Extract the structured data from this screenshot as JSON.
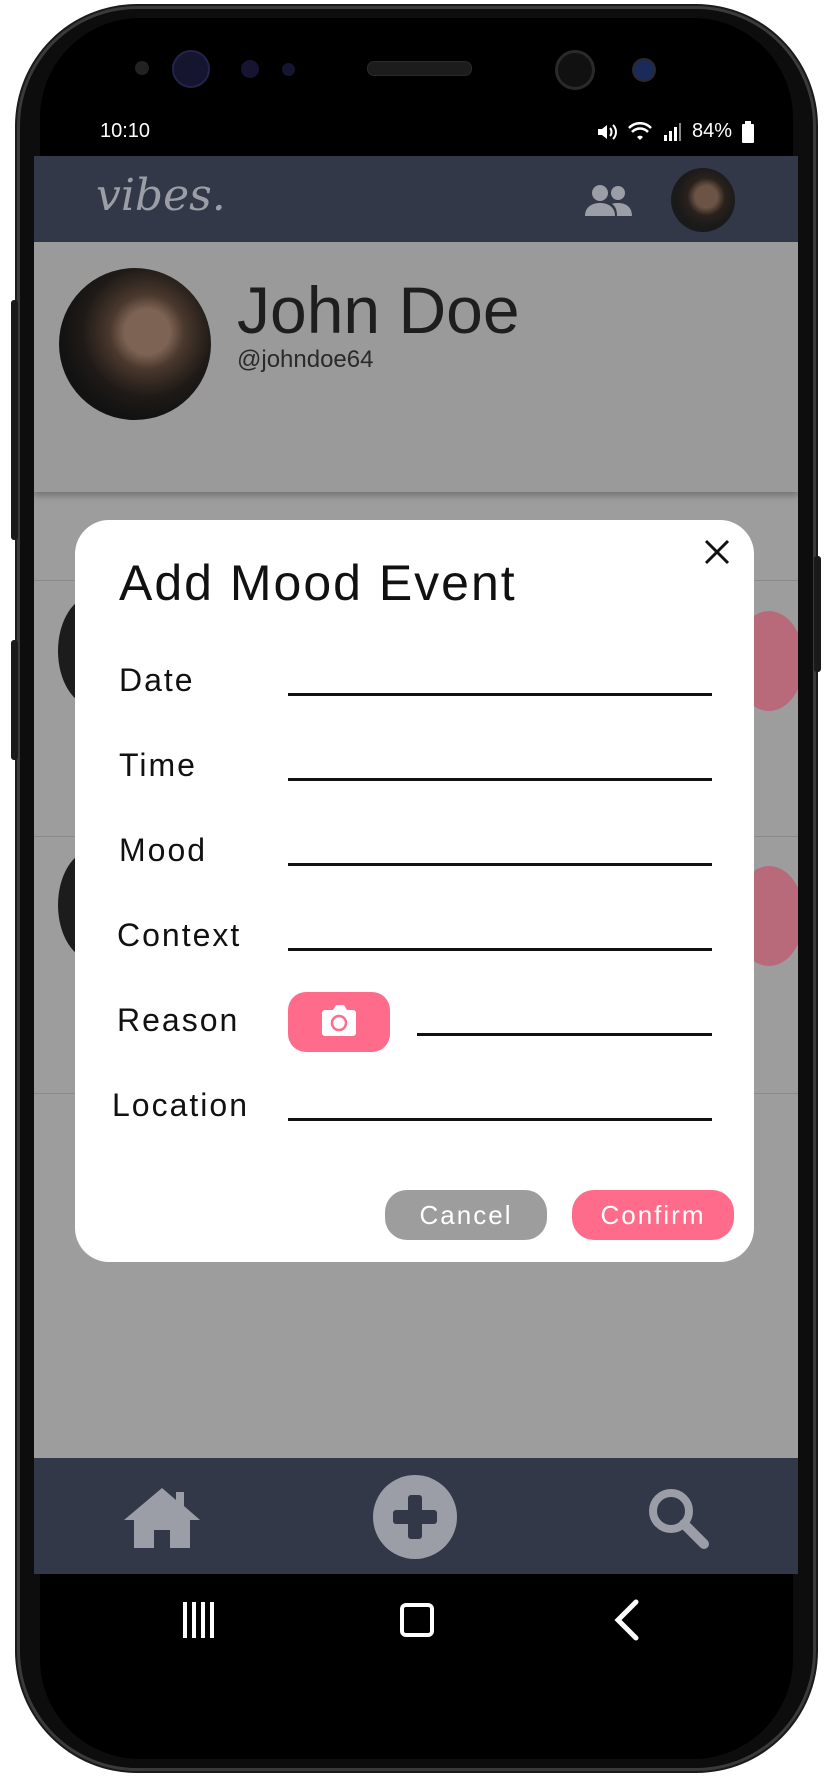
{
  "status_bar": {
    "time": "10:10",
    "battery": "84%"
  },
  "app": {
    "logo": "vibes."
  },
  "profile": {
    "name": "John Doe",
    "handle": "@johndoe64"
  },
  "dialog": {
    "title": "Add Mood Event",
    "fields": {
      "date": {
        "label": "Date",
        "value": ""
      },
      "time": {
        "label": "Time",
        "value": ""
      },
      "mood": {
        "label": "Mood",
        "value": ""
      },
      "context": {
        "label": "Context",
        "value": ""
      },
      "reason": {
        "label": "Reason",
        "value": ""
      },
      "location": {
        "label": "Location",
        "value": ""
      }
    },
    "cancel_label": "Cancel",
    "confirm_label": "Confirm"
  },
  "icons": {
    "friends": "friends-icon",
    "home": "home-icon",
    "add": "add-icon",
    "search": "search-icon",
    "camera": "camera-icon",
    "close": "close-icon"
  },
  "colors": {
    "header": "#333849",
    "accent": "#ff6b8a",
    "overlay": "#9d9d9d",
    "cancel": "#9d9d9d"
  }
}
